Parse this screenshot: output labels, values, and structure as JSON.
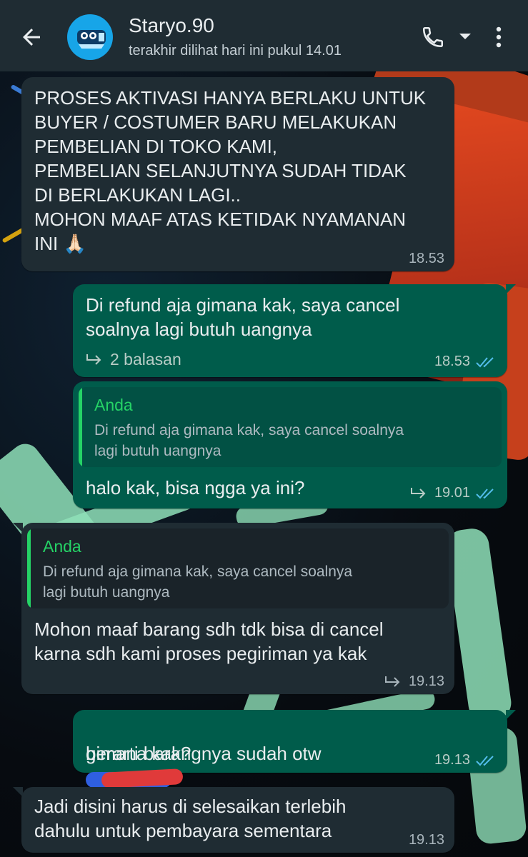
{
  "header": {
    "contact_name": "Staryo.90",
    "last_seen": "terakhir dilihat hari ini pukul 14.01",
    "icons": [
      "back-arrow-icon",
      "avatar",
      "phone-icon",
      "dropdown-caret-icon",
      "more-vert-icon"
    ]
  },
  "colors": {
    "app_bar": "#1f2c33",
    "incoming_bubble": "#1f2c33",
    "outgoing_bubble": "#005c4b",
    "quote_accent": "#25d366",
    "read_ticks": "#53bdeb"
  },
  "messages": [
    {
      "direction": "incoming",
      "text": "PROSES AKTIVASI HANYA BERLAKU UNTUK\nBUYER / COSTUMER BARU MELAKUKAN\nPEMBELIAN DI TOKO KAMI,\nPEMBELIAN SELANJUTNYA SUDAH TIDAK\nDI BERLAKUKAN LAGI..\nMOHON MAAF ATAS KETIDAK NYAMANAN\nINI 🙏🏻",
      "time": "18.53"
    },
    {
      "direction": "outgoing",
      "text": "Di refund aja gimana kak, saya cancel\nsoalnya lagi butuh uangnya",
      "replies": "2 balasan",
      "time": "18.53",
      "status": "read"
    },
    {
      "direction": "outgoing",
      "quote_author": "Anda",
      "quote_text": "Di refund aja gimana kak, saya cancel soalnya\nlagi butuh uangnya",
      "text": "halo kak, bisa ngga ya ini?",
      "time": "19.01",
      "status": "read"
    },
    {
      "direction": "incoming",
      "quote_author": "Anda",
      "quote_text": "Di refund aja gimana kak, saya cancel soalnya\nlagi butuh uangnya",
      "text": "Mohon maaf barang sdh tdk bisa di cancel\nkarna sdh kami proses pegiriman ya kak",
      "time": "19.13"
    },
    {
      "direction": "outgoing",
      "text_before": "berarti barangnya sudah otw",
      "text_after": "atau",
      "text_line2": "gimana kak?",
      "time": "19.13",
      "status": "read"
    },
    {
      "direction": "incoming",
      "text": "Jadi disini harus di selesaikan terlebih\ndahulu untuk pembayara sementara",
      "time": "19.13"
    }
  ]
}
